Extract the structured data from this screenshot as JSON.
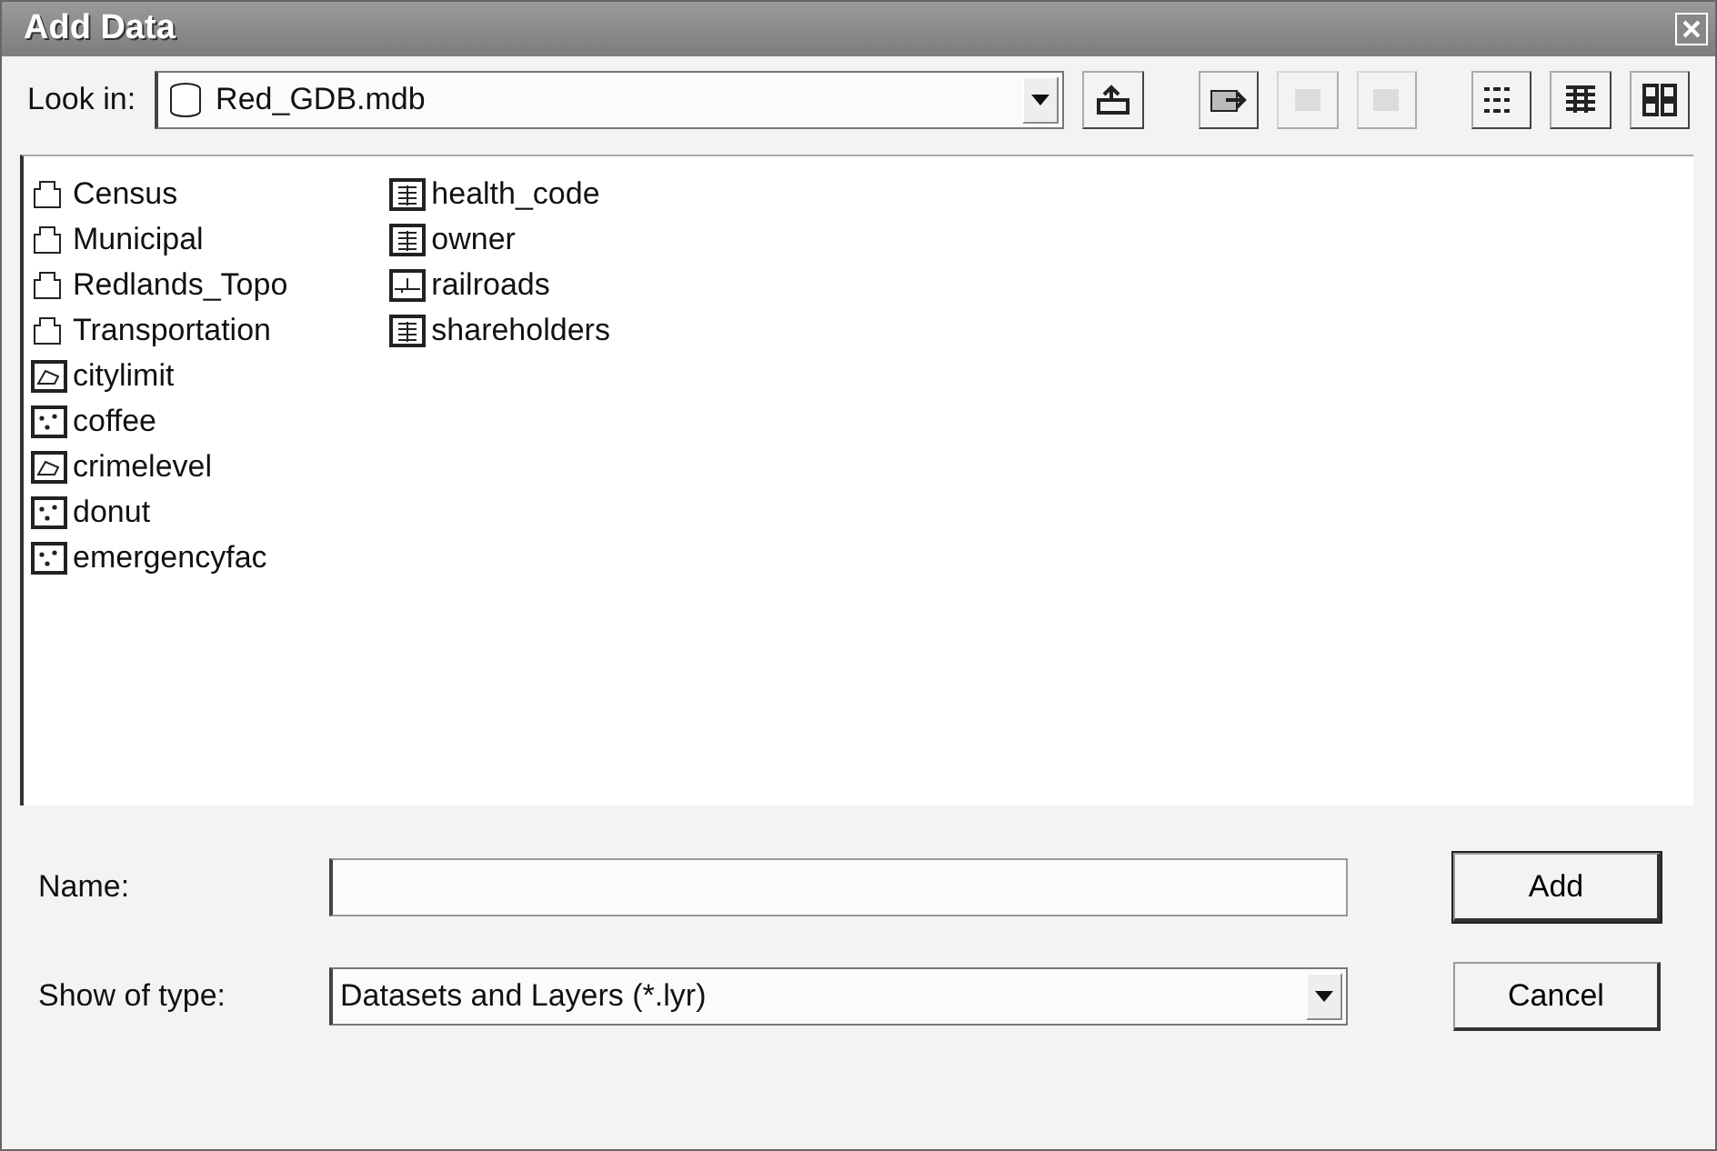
{
  "window": {
    "title": "Add Data"
  },
  "look_in": {
    "label": "Look in:",
    "value": "Red_GDB.mdb"
  },
  "toolbar": [
    {
      "kind": "up",
      "disabled": false
    },
    {
      "kind": "connect",
      "disabled": false
    },
    {
      "kind": "blank",
      "disabled": true
    },
    {
      "kind": "blank",
      "disabled": true
    },
    {
      "kind": "list",
      "disabled": false
    },
    {
      "kind": "details",
      "disabled": false
    },
    {
      "kind": "thumbnails",
      "disabled": false
    }
  ],
  "files": [
    {
      "name": "Census",
      "kind": "dataset"
    },
    {
      "name": "Municipal",
      "kind": "dataset"
    },
    {
      "name": "Redlands_Topo",
      "kind": "dataset"
    },
    {
      "name": "Transportation",
      "kind": "dataset"
    },
    {
      "name": "citylimit",
      "kind": "polygon"
    },
    {
      "name": "coffee",
      "kind": "point"
    },
    {
      "name": "crimelevel",
      "kind": "polygon"
    },
    {
      "name": "donut",
      "kind": "point"
    },
    {
      "name": "emergencyfac",
      "kind": "point"
    },
    {
      "name": "health_code",
      "kind": "table"
    },
    {
      "name": "owner",
      "kind": "table"
    },
    {
      "name": "railroads",
      "kind": "line"
    },
    {
      "name": "shareholders",
      "kind": "table"
    }
  ],
  "name_field": {
    "label": "Name:"
  },
  "type_field": {
    "label": "Show of type:",
    "value": "Datasets and Layers (*.lyr)"
  },
  "buttons": [
    "Add",
    "Cancel"
  ]
}
